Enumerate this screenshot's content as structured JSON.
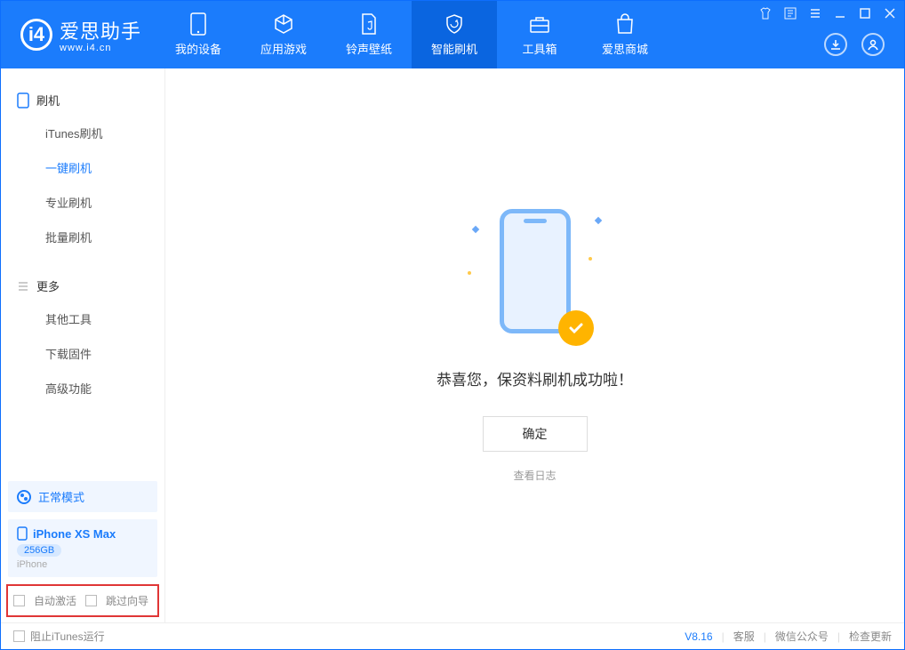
{
  "app": {
    "name": "爱思助手",
    "domain": "www.i4.cn"
  },
  "tabs": [
    {
      "label": "我的设备"
    },
    {
      "label": "应用游戏"
    },
    {
      "label": "铃声壁纸"
    },
    {
      "label": "智能刷机"
    },
    {
      "label": "工具箱"
    },
    {
      "label": "爱思商城"
    }
  ],
  "sidebar": {
    "section1": {
      "title": "刷机",
      "items": [
        "iTunes刷机",
        "一键刷机",
        "专业刷机",
        "批量刷机"
      ]
    },
    "section2": {
      "title": "更多",
      "items": [
        "其他工具",
        "下载固件",
        "高级功能"
      ]
    }
  },
  "device": {
    "mode": "正常模式",
    "name": "iPhone XS Max",
    "capacity": "256GB",
    "type": "iPhone"
  },
  "options": {
    "auto_activate": "自动激活",
    "skip_guide": "跳过向导"
  },
  "main": {
    "success_text": "恭喜您，保资料刷机成功啦！",
    "ok_button": "确定",
    "view_log": "查看日志"
  },
  "footer": {
    "block_itunes": "阻止iTunes运行",
    "version": "V8.16",
    "service": "客服",
    "wechat": "微信公众号",
    "update": "检查更新"
  }
}
